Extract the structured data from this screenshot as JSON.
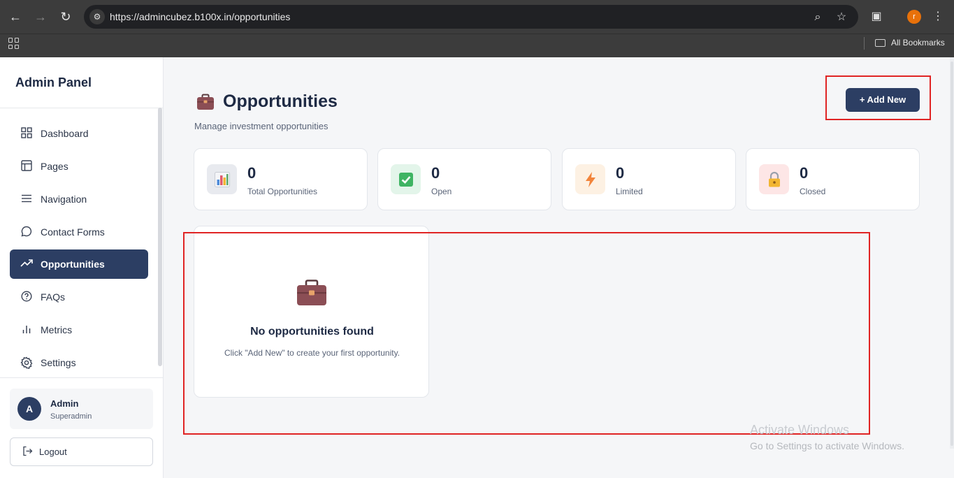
{
  "browser": {
    "url": "https://admincubez.b100x.in/opportunities",
    "profile_initial": "r",
    "bookmarks_label": "All Bookmarks"
  },
  "sidebar": {
    "brand": "Admin Panel",
    "items": [
      {
        "label": "Dashboard",
        "icon": "grid-icon",
        "active": false
      },
      {
        "label": "Pages",
        "icon": "layout-icon",
        "active": false
      },
      {
        "label": "Navigation",
        "icon": "menu-icon",
        "active": false
      },
      {
        "label": "Contact Forms",
        "icon": "chat-icon",
        "active": false
      },
      {
        "label": "Opportunities",
        "icon": "trending-up-icon",
        "active": true
      },
      {
        "label": "FAQs",
        "icon": "help-circle-icon",
        "active": false
      },
      {
        "label": "Metrics",
        "icon": "bar-chart-icon",
        "active": false
      },
      {
        "label": "Settings",
        "icon": "gear-icon",
        "active": false
      }
    ],
    "user": {
      "initial": "A",
      "name": "Admin",
      "role": "Superadmin"
    },
    "logout_label": "Logout"
  },
  "main": {
    "title": "Opportunities",
    "subtitle": "Manage investment opportunities",
    "add_button": "+ Add New",
    "stats": [
      {
        "value": "0",
        "label": "Total Opportunities",
        "icon": "bar-chart-icon"
      },
      {
        "value": "0",
        "label": "Open",
        "icon": "check-box-icon"
      },
      {
        "value": "0",
        "label": "Limited",
        "icon": "lightning-icon"
      },
      {
        "value": "0",
        "label": "Closed",
        "icon": "lock-icon"
      }
    ],
    "empty_state": {
      "title": "No opportunities found",
      "subtitle": "Click \"Add New\" to create your first opportunity."
    }
  },
  "watermark": {
    "title": "Activate Windows",
    "subtitle": "Go to Settings to activate Windows."
  },
  "colors": {
    "primary": "#2c3e63",
    "highlight": "#e02424",
    "background": "#f5f6f8"
  }
}
